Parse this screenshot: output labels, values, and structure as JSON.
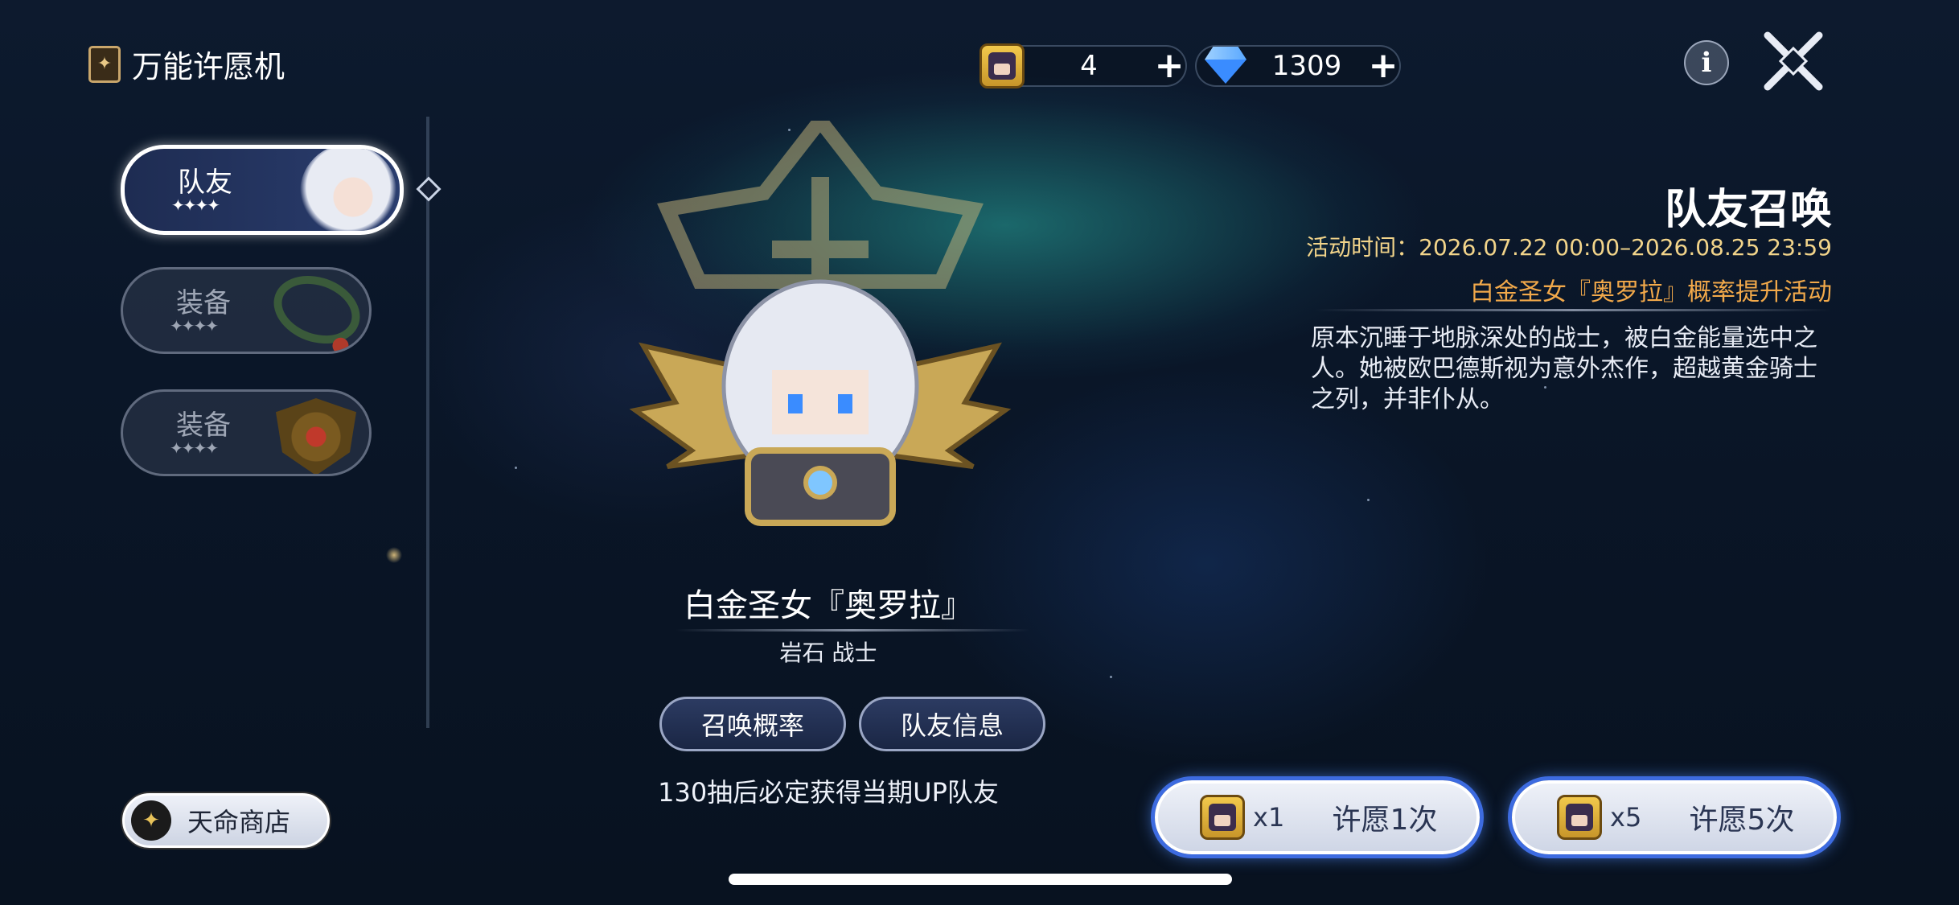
{
  "header": {
    "title": "万能许愿机",
    "title_icon": "card-icon"
  },
  "currency": {
    "tickets": {
      "value": "4",
      "icon": "wish-ticket-icon"
    },
    "gems": {
      "value": "1309",
      "icon": "diamond-icon"
    },
    "plus": "+"
  },
  "top_right": {
    "info_icon": "i",
    "close_icon": "close-icon"
  },
  "tabs": [
    {
      "label": "队友",
      "stars": "✦✦✦✦",
      "active": true
    },
    {
      "label": "装备",
      "stars": "✦✦✦✦",
      "active": false
    },
    {
      "label": "装备",
      "stars": "✦✦✦✦",
      "active": false
    }
  ],
  "character": {
    "name": "白金圣女『奥罗拉』",
    "type": "岩石 战士"
  },
  "buttons": {
    "rates": "召唤概率",
    "info": "队友信息"
  },
  "pity_note": "130抽后必定获得当期UP队友",
  "summon": {
    "title": "队友召唤",
    "time": "活动时间：2026.07.22 00:00–2026.08.25 23:59",
    "rate_up": "白金圣女『奥罗拉』概率提升活动",
    "description": "原本沉睡于地脉深处的战士，被白金能量选中之人。她被欧巴德斯视为意外杰作，超越黄金骑士之列，并非仆从。"
  },
  "wish": {
    "single": {
      "count": "x1",
      "label": "许愿1次"
    },
    "multi": {
      "count": "x5",
      "label": "许愿5次"
    }
  },
  "shop": {
    "label": "天命商店",
    "icon": "crown-icon"
  },
  "colors": {
    "accent_gold": "#f2d48a",
    "rate_orange": "#f2a94a",
    "wish_glow": "#3d6be0"
  }
}
